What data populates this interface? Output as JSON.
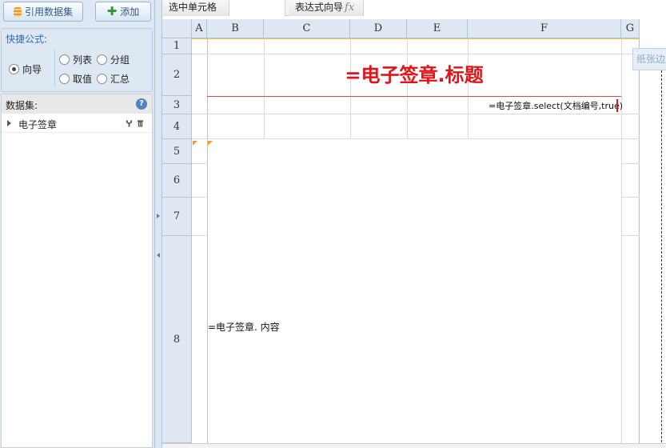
{
  "left_panel": {
    "ref_dataset_button": "引用数据集",
    "add_button": "添加",
    "quick_formula": {
      "title": "快捷公式:",
      "options": [
        {
          "label": "向导",
          "checked": true
        },
        {
          "label": "列表",
          "checked": false
        },
        {
          "label": "分组",
          "checked": false
        },
        {
          "label": "取值",
          "checked": false
        },
        {
          "label": "汇总",
          "checked": false
        }
      ]
    },
    "datasets": {
      "title": "数据集:",
      "help": "?",
      "items": [
        {
          "label": "电子签章"
        }
      ]
    }
  },
  "formula_bar": {
    "selected_cell_label": "选中单元格",
    "selected_cell_value": "",
    "expression_wizard_label": "表达式向导",
    "fx": "fx",
    "expression_value": ""
  },
  "sheet": {
    "columns": [
      "A",
      "B",
      "C",
      "D",
      "E",
      "F",
      "G"
    ],
    "rows": [
      "1",
      "2",
      "3",
      "4",
      "5",
      "6",
      "7",
      "8"
    ],
    "cells": {
      "title": "=电子签章.标题",
      "select_formula": "=电子签章.select(文档编号,true)",
      "content_formula": "=电子签章. 内容"
    },
    "paper_margin_tab": "纸张边距"
  },
  "colors": {
    "title_red": "#e0141a",
    "header_bg": "#dfe7f2",
    "panel_bg": "#dde8f3",
    "margin_line": "#f0c040"
  }
}
